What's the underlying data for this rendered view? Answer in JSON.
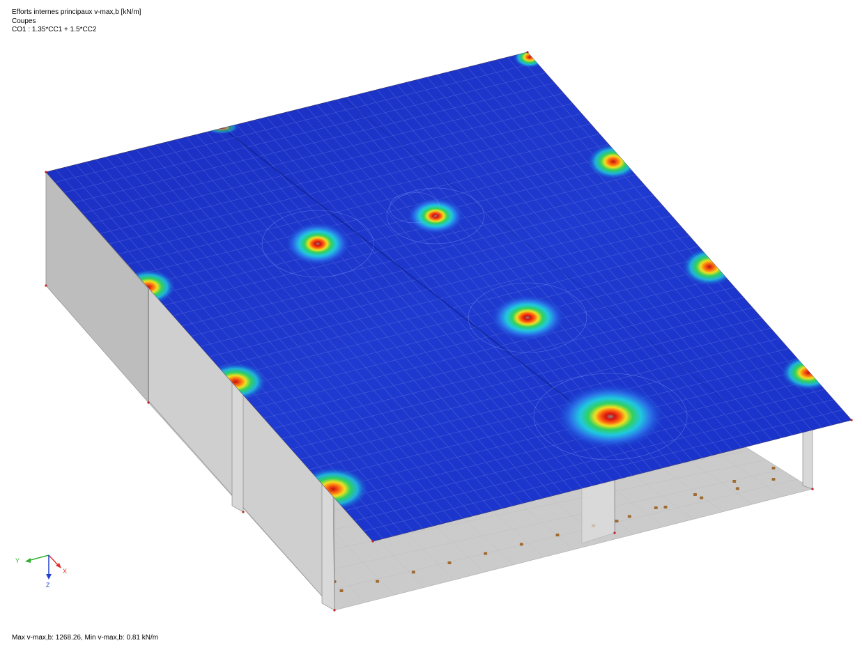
{
  "header": {
    "title": "Efforts internes principaux v-max,b [kN/m]",
    "subtitle": "Coupes",
    "combination": "CO1 : 1.35*CC1 + 1.5*CC2"
  },
  "status": {
    "summary": "Max v-max,b: 1268.26, Min v-max,b: 0.81 kN/m"
  },
  "axes": {
    "x_label": "X",
    "y_label": "Y",
    "z_label": "Z"
  },
  "colors": {
    "slab_base": "#1530c8",
    "grid_line": "#b8c4f0",
    "wall": "#c6c6c6",
    "hot_peak": "#e01010",
    "warm": "#f0e020",
    "mid": "#20d060",
    "x_axis": "#e03030",
    "y_axis": "#30b030",
    "z_axis": "#2040d0"
  }
}
